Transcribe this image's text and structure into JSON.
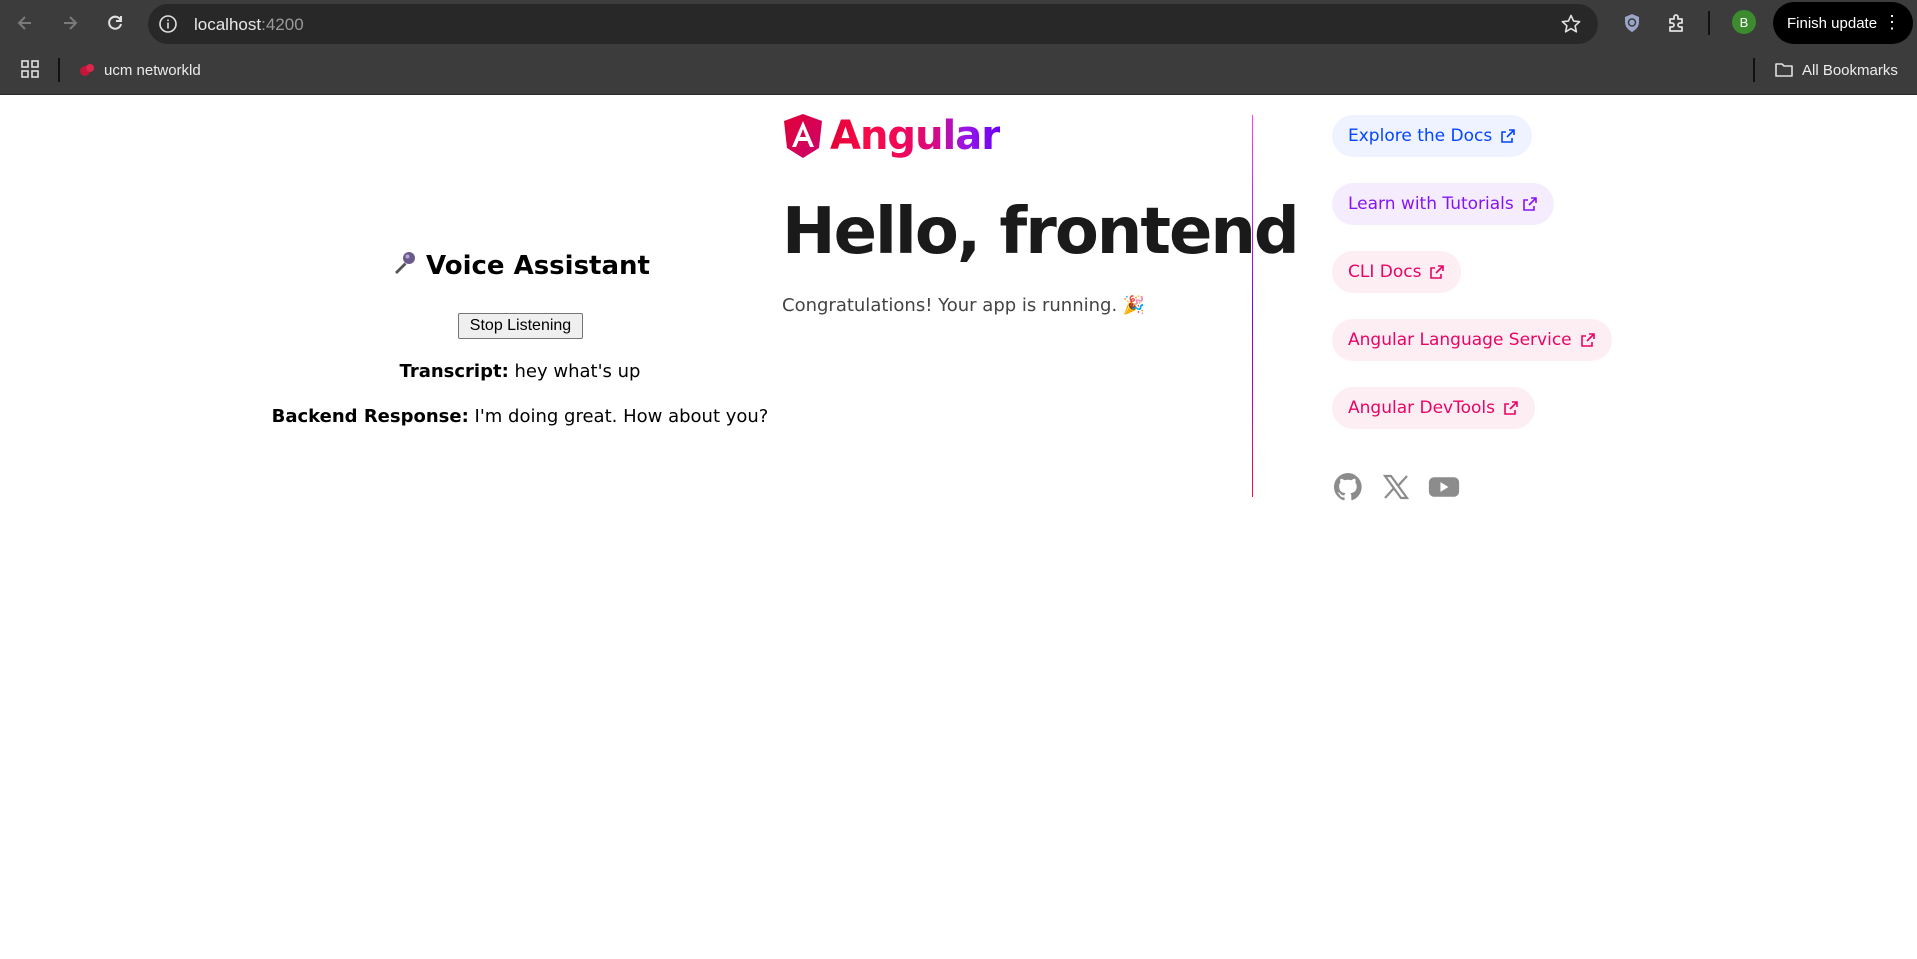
{
  "browser": {
    "url_host": "localhost",
    "url_port": ":4200",
    "finish_update_label": "Finish update",
    "avatar_letter": "B",
    "bookmarks": [
      {
        "label": "ucm networkld"
      }
    ],
    "all_bookmarks_label": "All Bookmarks"
  },
  "voice_assistant": {
    "title": "Voice Assistant",
    "button_label": "Stop Listening",
    "transcript_label": "Transcript:",
    "transcript_value": "hey what's up",
    "response_label": "Backend Response:",
    "response_value": "I'm doing great. How about you?"
  },
  "hero": {
    "logo_text": "Angular",
    "heading": "Hello, frontend",
    "subtitle": "Congratulations! Your app is running. 🎉"
  },
  "links": [
    {
      "label": "Explore the Docs",
      "color": "#0546ff",
      "bg": "#eef3ff"
    },
    {
      "label": "Learn with Tutorials",
      "color": "#8514f5",
      "bg": "#f5edfe"
    },
    {
      "label": "CLI Docs",
      "color": "#e90464",
      "bg": "#fdeef3"
    },
    {
      "label": "Angular Language Service",
      "color": "#e90464",
      "bg": "#fdeef3"
    },
    {
      "label": "Angular DevTools",
      "color": "#e90464",
      "bg": "#fdeef3"
    }
  ],
  "socials": [
    {
      "icon": "github-icon"
    },
    {
      "icon": "x-twitter-icon"
    },
    {
      "icon": "youtube-icon"
    }
  ]
}
